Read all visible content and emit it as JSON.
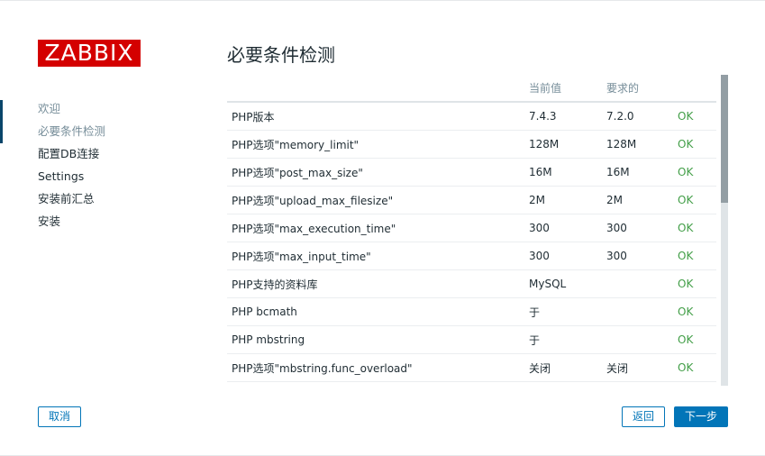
{
  "logo": {
    "text": "ZABBIX",
    "color": "#d40000"
  },
  "sidebar": {
    "items": [
      {
        "label": "欢迎",
        "state": "done"
      },
      {
        "label": "必要条件检测",
        "state": "current"
      },
      {
        "label": "配置DB连接",
        "state": "pending"
      },
      {
        "label": "Settings",
        "state": "pending"
      },
      {
        "label": "安装前汇总",
        "state": "pending"
      },
      {
        "label": "安装",
        "state": "pending"
      }
    ]
  },
  "page": {
    "title": "必要条件检测"
  },
  "table": {
    "headers": [
      "",
      "当前值",
      "要求的",
      ""
    ],
    "rows": [
      {
        "name": "PHP版本",
        "current": "7.4.3",
        "required": "7.2.0",
        "status": "OK"
      },
      {
        "name": "PHP选项\"memory_limit\"",
        "current": "128M",
        "required": "128M",
        "status": "OK"
      },
      {
        "name": "PHP选项\"post_max_size\"",
        "current": "16M",
        "required": "16M",
        "status": "OK"
      },
      {
        "name": "PHP选项\"upload_max_filesize\"",
        "current": "2M",
        "required": "2M",
        "status": "OK"
      },
      {
        "name": "PHP选项\"max_execution_time\"",
        "current": "300",
        "required": "300",
        "status": "OK"
      },
      {
        "name": "PHP选项\"max_input_time\"",
        "current": "300",
        "required": "300",
        "status": "OK"
      },
      {
        "name": "PHP支持的资料库",
        "current": "MySQL",
        "required": "",
        "status": "OK"
      },
      {
        "name": "PHP bcmath",
        "current": "于",
        "required": "",
        "status": "OK"
      },
      {
        "name": "PHP mbstring",
        "current": "于",
        "required": "",
        "status": "OK"
      },
      {
        "name": "PHP选项\"mbstring.func_overload\"",
        "current": "关闭",
        "required": "关闭",
        "status": "OK"
      }
    ]
  },
  "buttons": {
    "cancel": "取消",
    "back": "返回",
    "next": "下一步"
  },
  "colors": {
    "accent": "#0275b8",
    "ok": "#429e47",
    "muted": "#768d99"
  }
}
